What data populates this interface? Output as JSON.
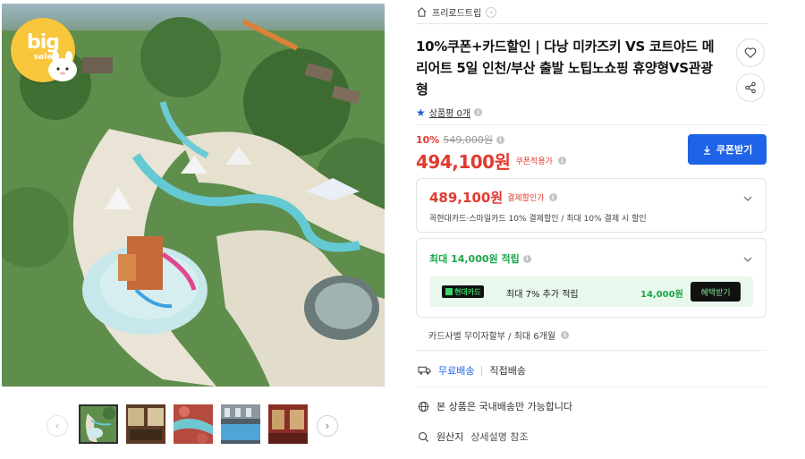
{
  "gallery": {
    "badge_big": "big",
    "badge_sale": "sale",
    "thumbnails": [
      {
        "name": "waterpark",
        "active": true
      },
      {
        "name": "restaurant",
        "active": false
      },
      {
        "name": "lazy-river",
        "active": false
      },
      {
        "name": "pool",
        "active": false
      },
      {
        "name": "interior",
        "active": false
      }
    ],
    "prev_icon": "chevron-left-icon",
    "next_icon": "chevron-right-icon"
  },
  "store": {
    "icon": "home-icon",
    "name": "프리로드트립",
    "arrow": "›"
  },
  "product": {
    "title": "10%쿠폰+카드할인 | 다낭 미카즈키 VS 코트야드 메리어트 5일 인천/부산 출발 노팁노쇼핑 휴양형VS관광형",
    "review_label": "상품평 0개",
    "info_glyph": "i"
  },
  "price": {
    "discount_rate": "10%",
    "original_price": "549,000원",
    "final_price": "494,100원",
    "coupon_applied_label": "쿠폰적용가",
    "coupon_button_label": "쿠폰받기"
  },
  "card_discount": {
    "price": "489,100원",
    "label": "결제할인가",
    "description": "꼭현대카드·스마일카드 10% 결제할인 / 최대 10% 결제 시 할인"
  },
  "points": {
    "title": "최대 14,000원 적립",
    "card_badge": "현대카드",
    "promo_text": "최대 7% 추가 적립",
    "promo_amount": "14,000원",
    "benefit_button": "혜택받기"
  },
  "installment": {
    "text": "카드사별 무이자할부 / 최대 6개월"
  },
  "delivery": {
    "free_label": "무료배송",
    "direct_label": "직접배송"
  },
  "notices": {
    "domestic": "본 상품은 국내배송만 가능합니다",
    "origin_label": "원산지",
    "origin_value": "상세설명 참조"
  },
  "colors": {
    "accent_blue": "#1f63e8",
    "price_red": "#e33a2f",
    "point_green": "#1aa64a"
  }
}
